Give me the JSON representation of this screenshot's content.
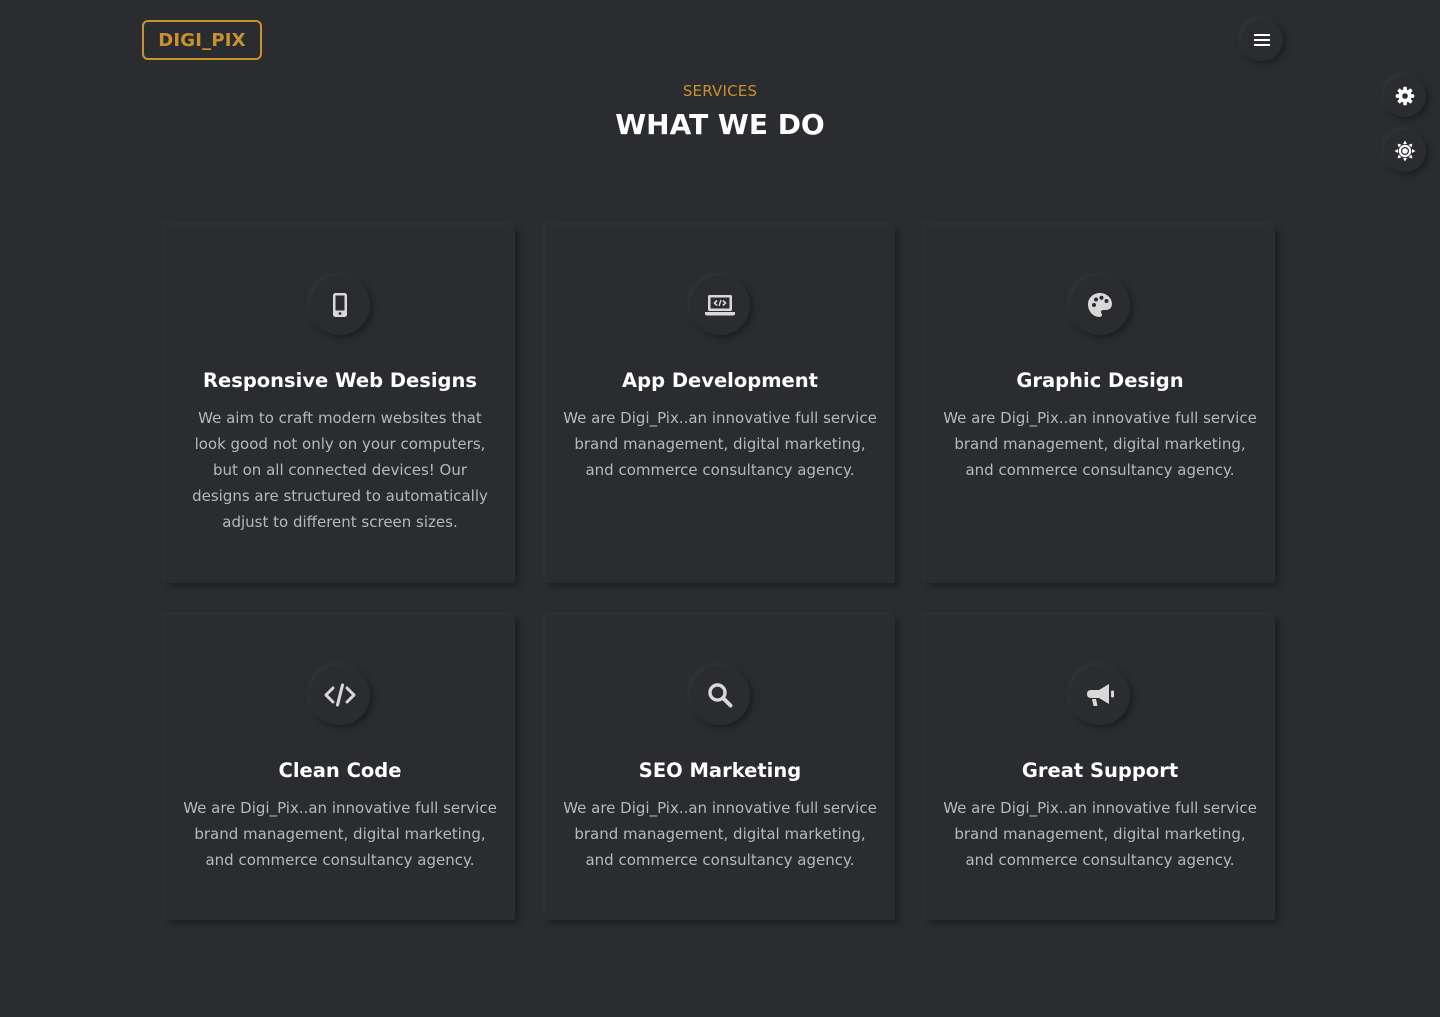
{
  "header": {
    "logo_text": "DIGI_PIX",
    "menu_icon": "hamburger-menu-icon"
  },
  "side_controls": {
    "settings_icon": "gear-icon",
    "theme_icon": "sun-icon"
  },
  "section": {
    "eyebrow": "SERVICES",
    "title": "WHAT WE DO"
  },
  "services": [
    {
      "icon": "mobile-phone-icon",
      "title": "Responsive Web Designs",
      "description": "We aim to craft modern websites that look good not only on your computers, but on all connected devices! Our designs are structured to automatically adjust to different screen sizes."
    },
    {
      "icon": "laptop-code-icon",
      "title": "App Development",
      "description": "We are Digi_Pix..an innovative full service brand management, digital marketing, and commerce consultancy agency."
    },
    {
      "icon": "palette-icon",
      "title": "Graphic Design",
      "description": "We are Digi_Pix..an innovative full service brand management, digital marketing, and commerce consultancy agency."
    },
    {
      "icon": "code-icon",
      "title": "Clean Code",
      "description": "We are Digi_Pix..an innovative full service brand management, digital marketing, and commerce consultancy agency."
    },
    {
      "icon": "search-icon",
      "title": "SEO Marketing",
      "description": "We are Digi_Pix..an innovative full service brand management, digital marketing, and commerce consultancy agency."
    },
    {
      "icon": "megaphone-icon",
      "title": "Great Support",
      "description": "We are Digi_Pix..an innovative full service brand management, digital marketing, and commerce consultancy agency."
    }
  ],
  "colors": {
    "background": "#2b2c30",
    "accent": "#c9932c",
    "text_muted": "#b7b8bb",
    "icon": "#d8d8d8"
  }
}
